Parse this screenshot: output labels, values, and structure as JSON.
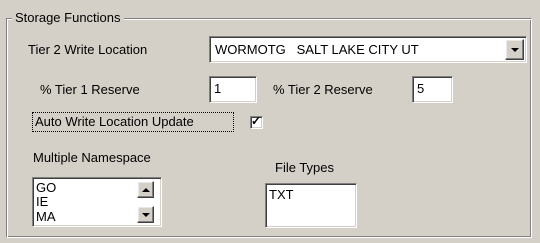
{
  "group": {
    "title": "Storage Functions"
  },
  "tier2_write_location": {
    "label": "Tier 2 Write Location",
    "value": "WORMOTG   SALT LAKE CITY UT"
  },
  "tier1_reserve": {
    "label": "% Tier 1 Reserve",
    "value": "1"
  },
  "tier2_reserve": {
    "label": "% Tier 2 Reserve",
    "value": "5"
  },
  "auto_write": {
    "label": "Auto Write Location Update",
    "checked": true,
    "check_glyph": "✓"
  },
  "namespace": {
    "label": "Multiple Namespace",
    "items": [
      "GO",
      "IE",
      "MA"
    ]
  },
  "file_types": {
    "label": "File Types",
    "value": "TXT"
  }
}
